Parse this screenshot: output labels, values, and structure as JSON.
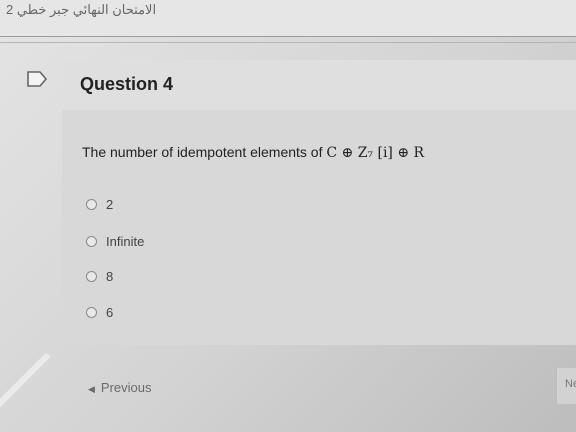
{
  "header": {
    "exam_title": "الامتحان النهائي جبر خطي 2"
  },
  "question": {
    "title": "Question 4",
    "text": "The number of idempotent elements of ",
    "math": "C ⊕ Z₇ [i] ⊕ R",
    "options": [
      {
        "label": "2",
        "selected": false
      },
      {
        "label": "Infinite",
        "selected": false
      },
      {
        "label": "8",
        "selected": false
      },
      {
        "label": "6",
        "selected": false
      }
    ]
  },
  "navigation": {
    "previous_label": "Previous",
    "next_label": "Ne"
  },
  "icons": {
    "flag": "flag-icon",
    "previous": "chevron-left-icon"
  }
}
